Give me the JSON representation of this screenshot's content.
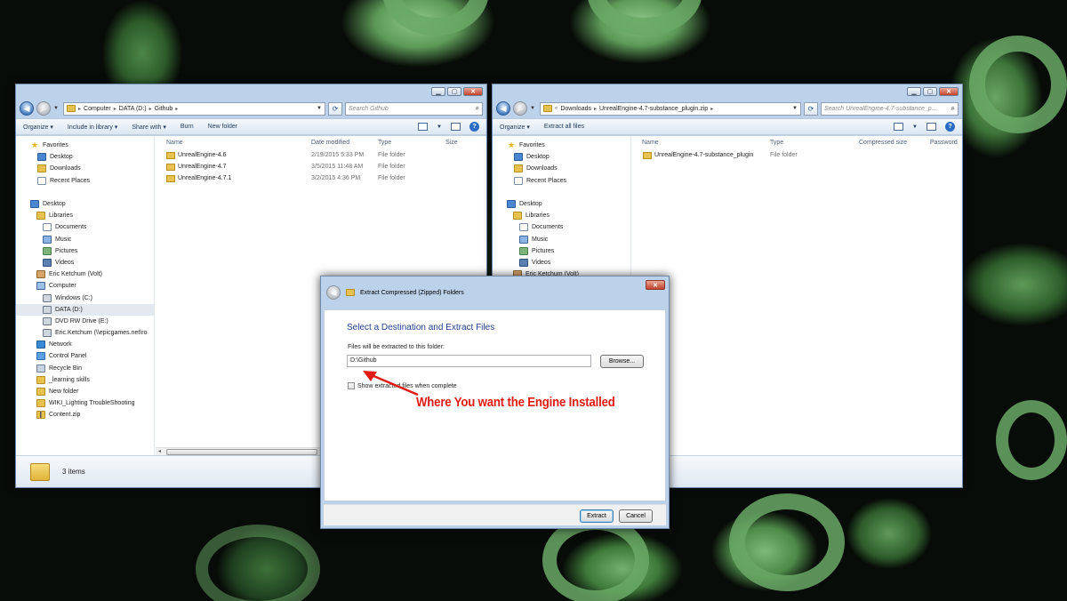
{
  "left_window": {
    "address": [
      "Computer",
      "DATA (D:)",
      "Github"
    ],
    "search_placeholder": "Search Github",
    "toolbar": [
      "Organize ▾",
      "Include in library ▾",
      "Share with ▾",
      "Burn",
      "New folder"
    ],
    "columns": [
      "Name",
      "Date modified",
      "Type",
      "Size"
    ],
    "files": [
      {
        "name": "UnrealEngine-4.6",
        "date": "2/19/2015 5:33 PM",
        "type": "File folder"
      },
      {
        "name": "UnrealEngine-4.7",
        "date": "3/5/2015 11:48 AM",
        "type": "File folder"
      },
      {
        "name": "UnrealEngine-4.7.1",
        "date": "3/2/2015 4:36 PM",
        "type": "File folder"
      }
    ],
    "status": "3 items",
    "nav": [
      {
        "label": "Favorites",
        "icon": "star-icon"
      },
      {
        "label": "Desktop",
        "icon": "desktop-icon"
      },
      {
        "label": "Downloads",
        "icon": "downloads-icon"
      },
      {
        "label": "Recent Places",
        "icon": "recent-places-icon"
      },
      {
        "label": "",
        "icon": ""
      },
      {
        "label": "Desktop",
        "icon": "desktop-icon"
      },
      {
        "label": "Libraries",
        "icon": "libraries-icon"
      },
      {
        "label": "Documents",
        "icon": "documents-icon"
      },
      {
        "label": "Music",
        "icon": "music-icon"
      },
      {
        "label": "Pictures",
        "icon": "pictures-icon"
      },
      {
        "label": "Videos",
        "icon": "videos-icon"
      },
      {
        "label": "Eric Ketchum (Volt)",
        "icon": "user-icon"
      },
      {
        "label": "Computer",
        "icon": "computer-icon"
      },
      {
        "label": "Windows (C:)",
        "icon": "drive-icon"
      },
      {
        "label": "DATA (D:)",
        "icon": "drive-icon"
      },
      {
        "label": "DVD RW Drive (E:)",
        "icon": "dvd-drive-icon"
      },
      {
        "label": "Eric.Ketchum (\\\\epicgames.net\\ro",
        "icon": "network-drive-icon"
      },
      {
        "label": "Network",
        "icon": "network-icon"
      },
      {
        "label": "Control Panel",
        "icon": "control-panel-icon"
      },
      {
        "label": "Recycle Bin",
        "icon": "recycle-bin-icon"
      },
      {
        "label": "_learning skills",
        "icon": "folder-icon"
      },
      {
        "label": "New folder",
        "icon": "folder-icon"
      },
      {
        "label": "WIKI_Lighting TroubleShooting",
        "icon": "folder-icon"
      },
      {
        "label": "Content.zip",
        "icon": "zip-icon"
      }
    ]
  },
  "right_window": {
    "address_prefix": "«",
    "address": [
      "Downloads",
      "UnrealEngine-4.7-substance_plugin.zip"
    ],
    "search_placeholder": "Search UnrealEngine-4.7-substance_p...",
    "toolbar": [
      "Organize ▾",
      "Extract all files"
    ],
    "columns": [
      "Name",
      "Type",
      "Compressed size",
      "Password"
    ],
    "files": [
      {
        "name": "UnrealEngine-4.7-substance_plugin",
        "type": "File folder"
      }
    ],
    "nav": [
      {
        "label": "Favorites",
        "icon": "star-icon"
      },
      {
        "label": "Desktop",
        "icon": "desktop-icon"
      },
      {
        "label": "Downloads",
        "icon": "downloads-icon"
      },
      {
        "label": "Recent Places",
        "icon": "recent-places-icon"
      },
      {
        "label": "",
        "icon": ""
      },
      {
        "label": "Desktop",
        "icon": "desktop-icon"
      },
      {
        "label": "Libraries",
        "icon": "libraries-icon"
      },
      {
        "label": "Documents",
        "icon": "documents-icon"
      },
      {
        "label": "Music",
        "icon": "music-icon"
      },
      {
        "label": "Pictures",
        "icon": "pictures-icon"
      },
      {
        "label": "Videos",
        "icon": "videos-icon"
      },
      {
        "label": "Eric Ketchum (Volt)",
        "icon": "user-icon"
      }
    ]
  },
  "dialog": {
    "title": "Extract Compressed (Zipped) Folders",
    "close_label": "✕",
    "heading": "Select a Destination and Extract Files",
    "label": "Files will be extracted to this folder:",
    "path": "D:\\Github",
    "browse_label": "Browse...",
    "checkbox_label": "Show extracted files when complete",
    "checkbox_checked": false,
    "extract_label": "Extract",
    "cancel_label": "Cancel"
  },
  "annotation": {
    "text": "Where You want the Engine Installed",
    "color": "#e01b13"
  }
}
